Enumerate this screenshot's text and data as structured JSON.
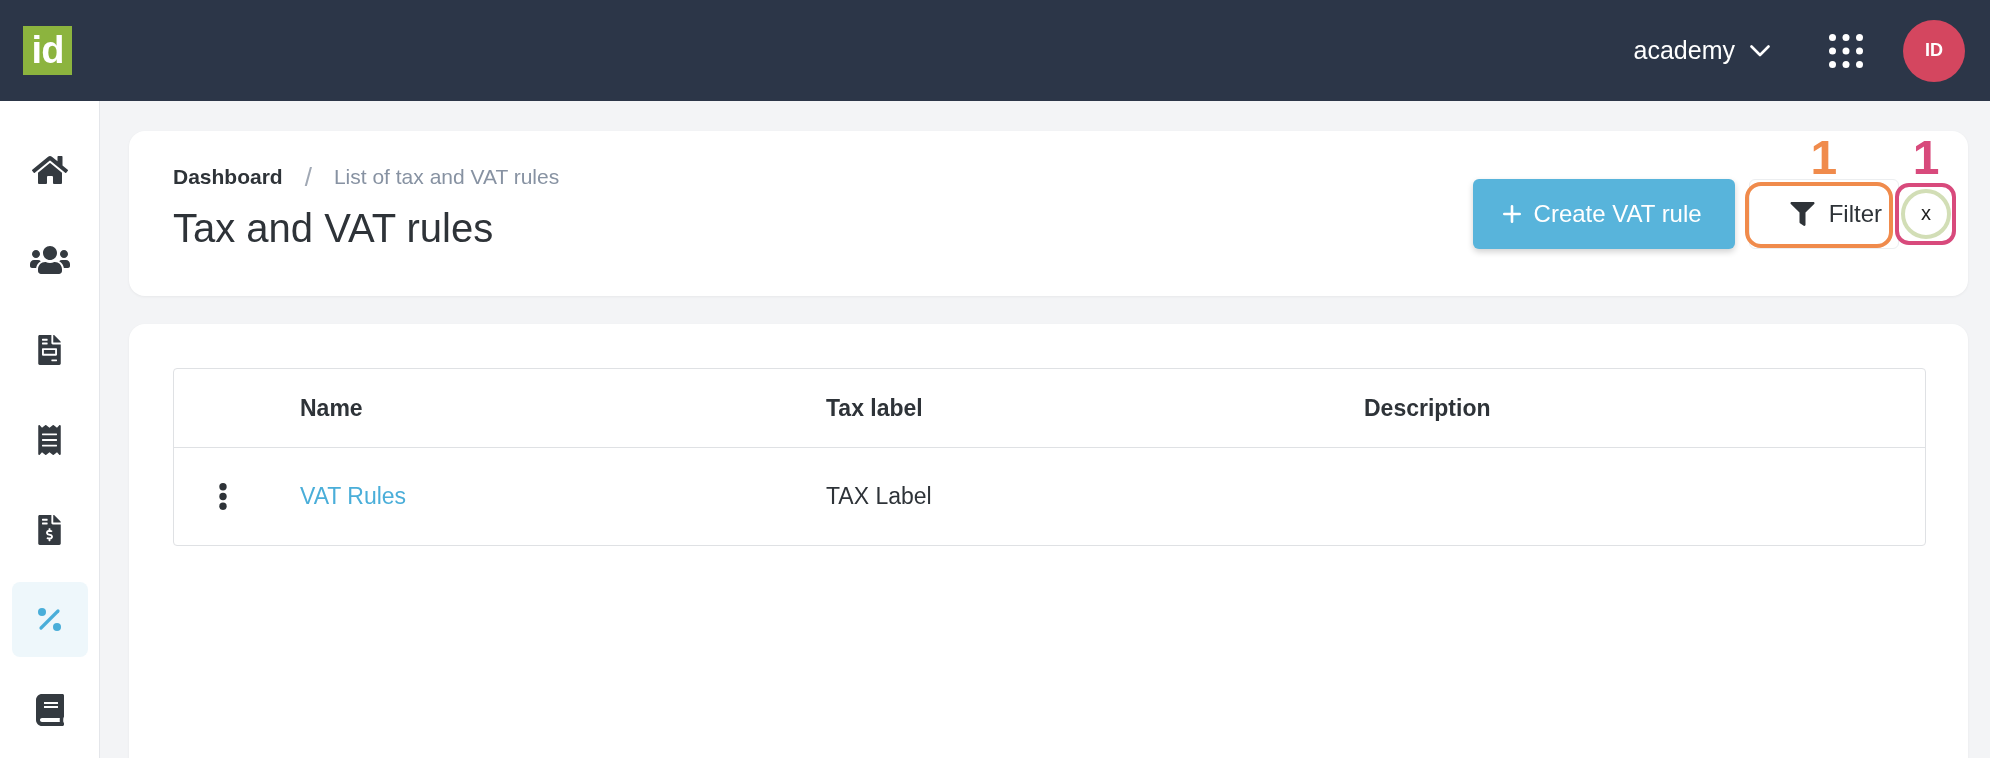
{
  "top_bar": {
    "logo": "id",
    "workspace": "academy",
    "avatar": "ID"
  },
  "sidebar": {
    "items": [
      {
        "kind": "home",
        "selected": false
      },
      {
        "kind": "people",
        "selected": false
      },
      {
        "kind": "document",
        "selected": false
      },
      {
        "kind": "receipt",
        "selected": false
      },
      {
        "kind": "invoice",
        "selected": false
      },
      {
        "kind": "percent",
        "selected": true
      },
      {
        "kind": "book",
        "selected": false
      }
    ]
  },
  "header": {
    "breadcrumb": [
      {
        "label": "Dashboard",
        "current": false
      },
      {
        "label": "List of tax and VAT rules",
        "current": true
      }
    ],
    "breadcrumb_separator": "/",
    "title": "Tax and VAT rules",
    "create_button": {
      "label": "Create VAT rule"
    },
    "filter_button": {
      "label": "Filter",
      "annotation": {
        "number": "1",
        "color": "#f08b4c"
      }
    },
    "clear_button": {
      "label": "x",
      "focused": true,
      "annotation": {
        "number": "1",
        "color": "#d84a7c"
      }
    }
  },
  "table": {
    "columns": [
      "Name",
      "Tax label",
      "Description"
    ],
    "rows": [
      {
        "name": "VAT Rules",
        "tax_label": "TAX Label"
      }
    ]
  }
}
